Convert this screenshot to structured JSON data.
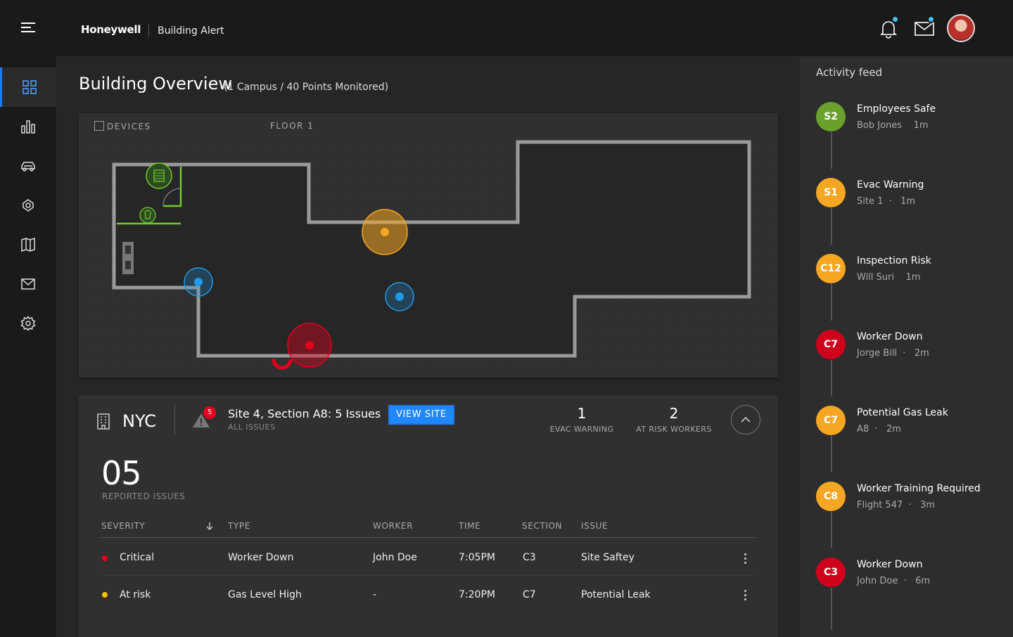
{
  "header": {
    "brand": "Honeywell",
    "product": "Building Alert",
    "colors": {
      "background": "#1a1a1a",
      "notification_dot": "#45c0f5",
      "accent": "#1c7cf4"
    },
    "icons": [
      "menu-icon",
      "bell-icon",
      "mail-icon",
      "avatar"
    ]
  },
  "sidenav": {
    "items": [
      {
        "icon": "dashboard-icon",
        "active": true
      },
      {
        "icon": "bar-chart-icon",
        "active": false
      },
      {
        "icon": "vehicle-icon",
        "active": false
      },
      {
        "icon": "drone-icon",
        "active": false
      },
      {
        "icon": "map-icon",
        "active": false
      },
      {
        "icon": "mail-icon",
        "active": false
      },
      {
        "icon": "settings-icon",
        "active": false
      }
    ]
  },
  "overview": {
    "title": "Building Overview",
    "subtitle": "(1 Campus / 40 Points Monitored)"
  },
  "map": {
    "devices_label": "DEVICES",
    "floor_label": "FLOOR 1",
    "markers": [
      {
        "type": "warning",
        "color": "#f5a623"
      },
      {
        "type": "worker",
        "color": "#1e9be9"
      },
      {
        "type": "worker",
        "color": "#1e9be9"
      },
      {
        "type": "critical",
        "color": "#e6001e"
      }
    ]
  },
  "site": {
    "location": "NYC",
    "issue_count_badge": "5",
    "title": "Site 4, Section A8: 5 Issues",
    "subtitle": "ALL ISSUES",
    "view_button": "VIEW SITE",
    "stats": [
      {
        "value": "1",
        "label": "EVAC WARNING"
      },
      {
        "value": "2",
        "label": "AT RISK WORKERS"
      }
    ],
    "reported_count": "05",
    "reported_label": "REPORTED ISSUES"
  },
  "table": {
    "columns": [
      "SEVERITY",
      "TYPE",
      "WORKER",
      "TIME",
      "SECTION",
      "ISSUE"
    ],
    "rows": [
      {
        "severity": "Critical",
        "severity_color": "#e6001e",
        "type": "Worker Down",
        "worker": "John Doe",
        "time": "7:05PM",
        "section": "C3",
        "issue": "Site Saftey"
      },
      {
        "severity": "At risk",
        "severity_color": "#f5c400",
        "type": "Gas Level High",
        "worker": "-",
        "time": "7:20PM",
        "section": "C7",
        "issue": "Potential Leak"
      }
    ]
  },
  "feed": {
    "title": "Activity feed",
    "items": [
      {
        "code": "S2",
        "color": "#6aa12c",
        "title": "Employees Safe",
        "meta": "Bob Jones    1m"
      },
      {
        "code": "S1",
        "color": "#f5a623",
        "title": "Evac Warning",
        "meta": "Site 1  ·   1m"
      },
      {
        "code": "C12",
        "color": "#f5a623",
        "title": "Inspection Risk",
        "meta": "Will Suri    1m"
      },
      {
        "code": "C7",
        "color": "#d0021b",
        "title": "Worker Down",
        "meta": "Jorge Bill  ·   2m"
      },
      {
        "code": "C7",
        "color": "#f5a623",
        "title": "Potential Gas Leak",
        "meta": "A8  ·   2m"
      },
      {
        "code": "C8",
        "color": "#f5a623",
        "title": "Worker Training Required",
        "meta": "Flight 547  ·   3m"
      },
      {
        "code": "C3",
        "color": "#d0021b",
        "title": "Worker Down",
        "meta": "John Doe  ·   6m"
      }
    ]
  }
}
